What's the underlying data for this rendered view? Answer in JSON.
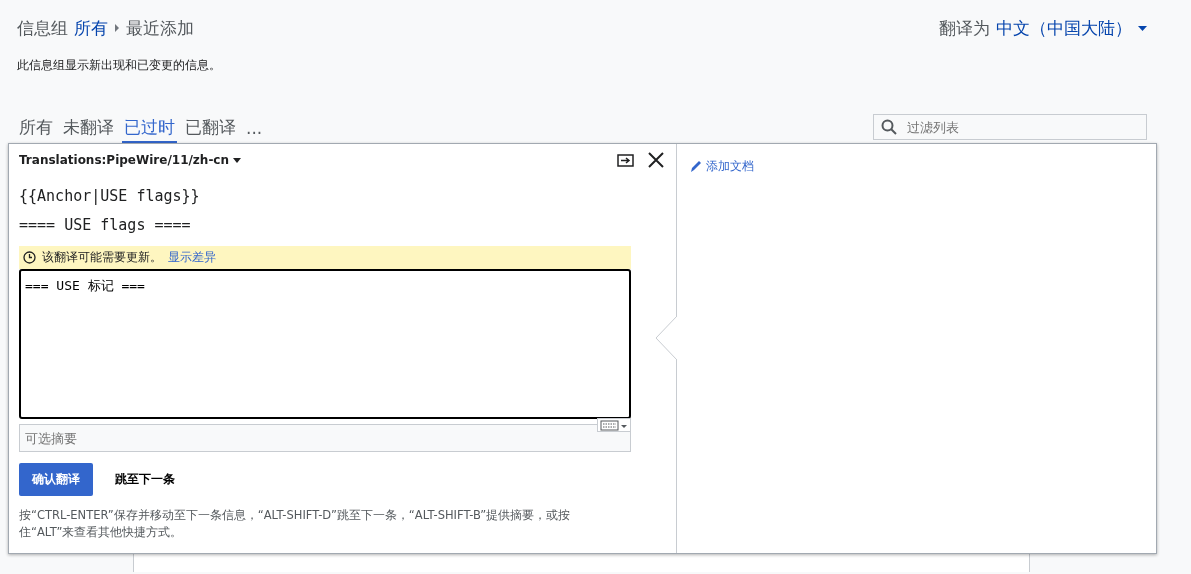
{
  "breadcrumb": {
    "label": "信息组",
    "group": "所有",
    "current": "最近添加"
  },
  "language": {
    "label": "翻译为",
    "value": "中文（中国大陆）"
  },
  "description": "此信息组显示新出现和已变更的信息。",
  "tabs": [
    {
      "label": "所有",
      "selected": false
    },
    {
      "label": "未翻译",
      "selected": false
    },
    {
      "label": "已过时",
      "selected": true
    },
    {
      "label": "已翻译",
      "selected": false
    },
    {
      "label": "...",
      "selected": false
    }
  ],
  "filter": {
    "placeholder": "过滤列表"
  },
  "editor": {
    "title": "Translations:PipeWire/11/zh-cn",
    "source": [
      "{{Anchor|USE flags}}",
      "==== USE flags ===="
    ],
    "warning": {
      "text": "该翻译可能需要更新。",
      "link": "显示差异"
    },
    "translation": "=== USE 标记 ===",
    "summary": {
      "placeholder": "可选摘要"
    },
    "confirm": "确认翻译",
    "skip": "跳至下一条",
    "hint": "按“CTRL-ENTER”保存并移动至下一条信息，“ALT-SHIFT-D”跳至下一条，“ALT-SHIFT-B”提供摘要，或按住“ALT”来查看其他快捷方式。",
    "add_doc": "添加文档"
  }
}
